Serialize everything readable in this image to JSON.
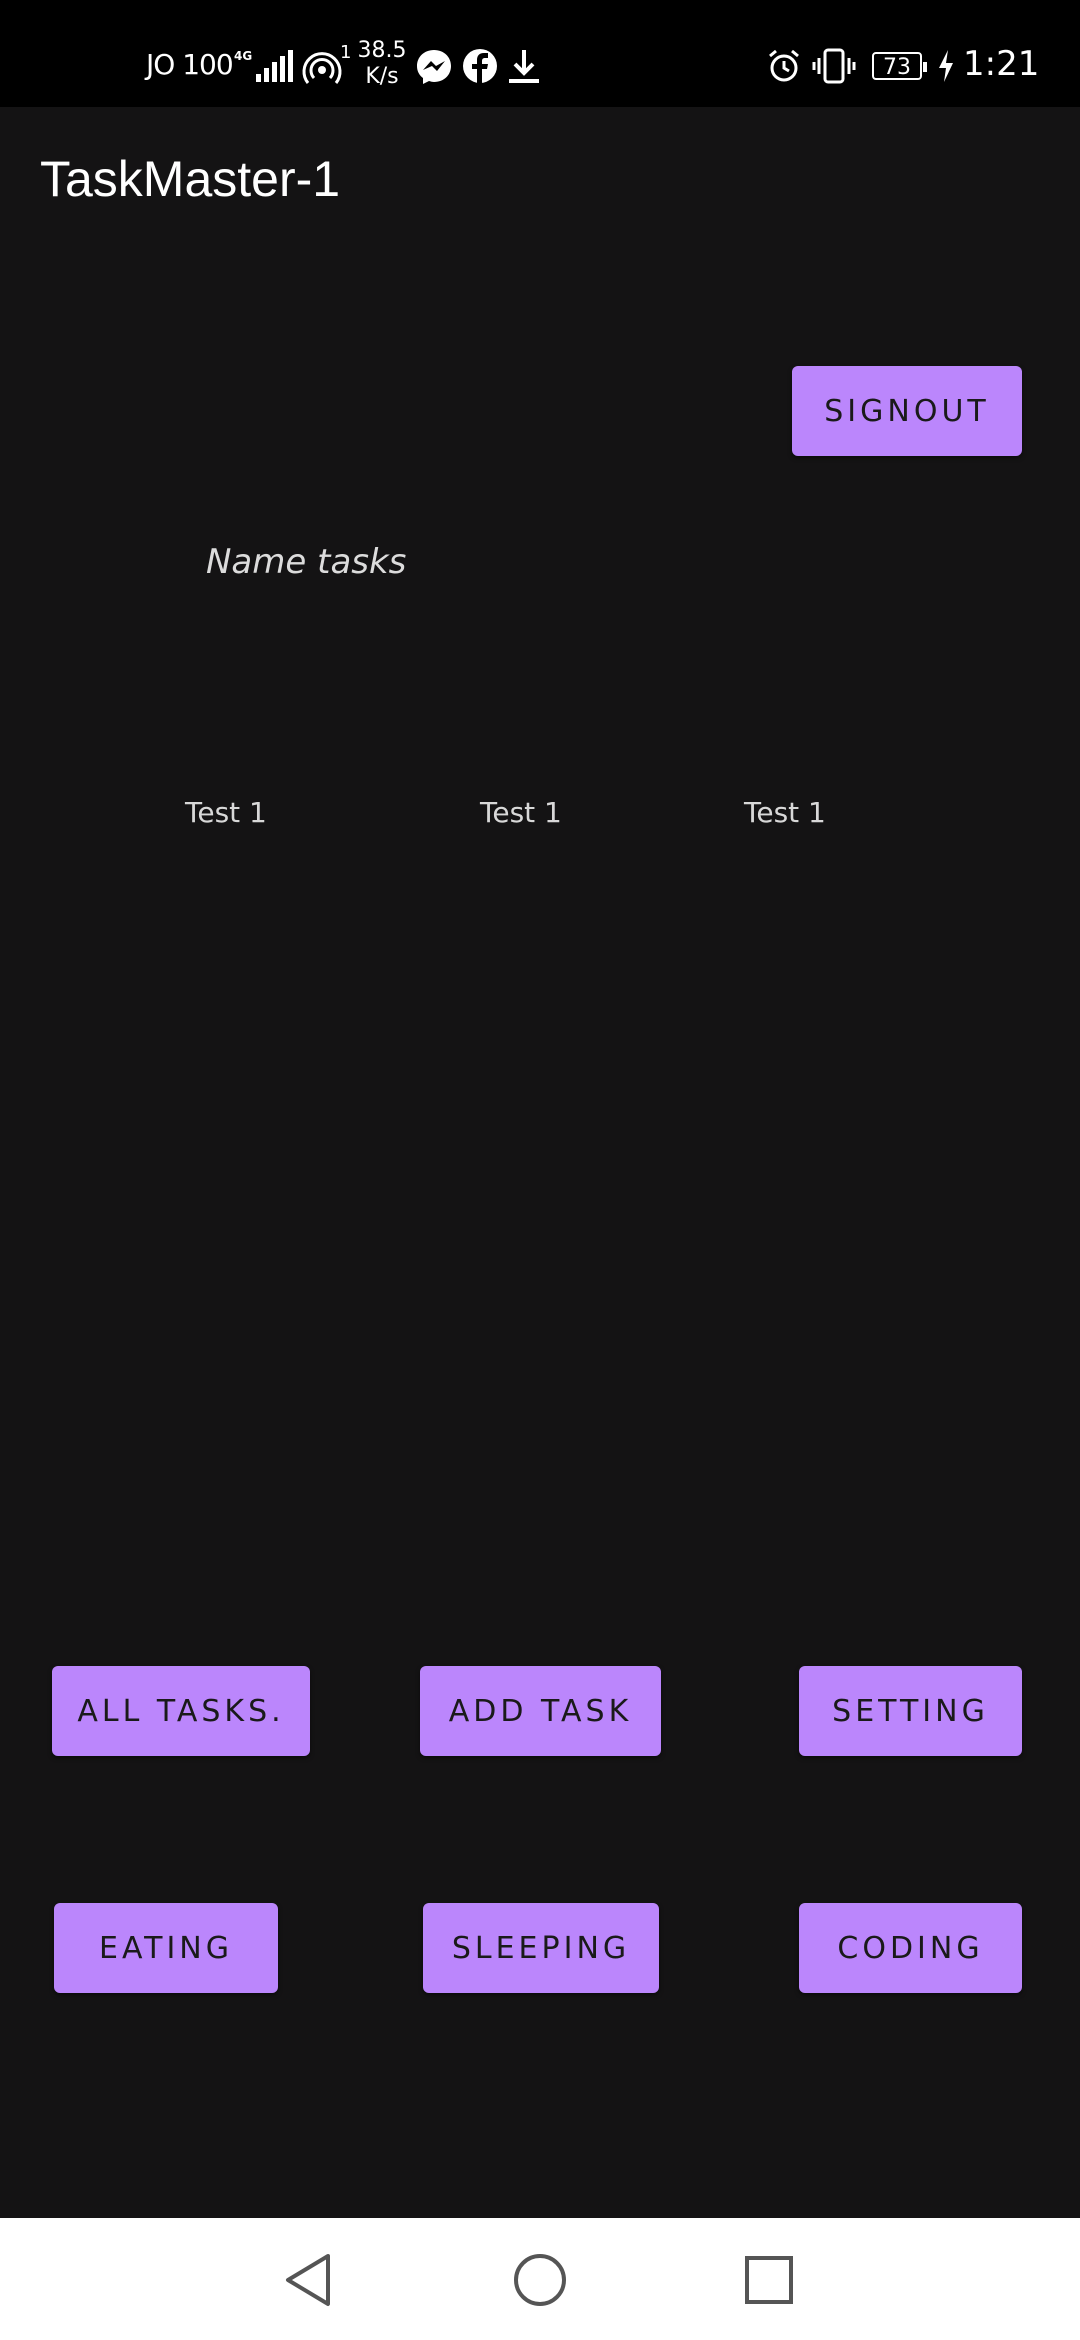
{
  "status_bar": {
    "carrier": "JO 100",
    "network": "4G",
    "hotspot_count": "1",
    "speed_value": "38.5",
    "speed_unit": "K/s",
    "battery": "73",
    "time": "1:21"
  },
  "app": {
    "title": "TaskMaster-1"
  },
  "buttons": {
    "signout": "SIGNOUT",
    "all_tasks": "ALL TASKS.",
    "add_task": "ADD TASK",
    "setting": "SETTING",
    "eating": "EATING",
    "sleeping": "SLEEPING",
    "coding": "CODING"
  },
  "name_label": "Name tasks",
  "tasks": [
    "Test 1",
    "Test 1",
    "Test 1"
  ],
  "colors": {
    "accent": "#bb86fc",
    "background": "#141314"
  },
  "icons": {
    "back": "back-triangle-icon",
    "home": "home-circle-icon",
    "recents": "recents-square-icon"
  }
}
